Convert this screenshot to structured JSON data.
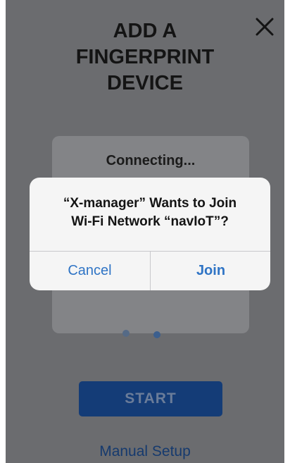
{
  "header": {
    "title": "ADD A\nFINGERPRINT\nDEVICE",
    "close_icon": "close-x"
  },
  "status_card": {
    "status_text": "Connecting..."
  },
  "start_button": {
    "label": "START"
  },
  "manual_setup_link": {
    "label": "Manual Setup"
  },
  "alert": {
    "message": "“X-manager” Wants to Join\nWi-Fi Network “navIoT”?",
    "cancel_label": "Cancel",
    "join_label": "Join"
  },
  "colors": {
    "overlay_background": "#6b6c6f",
    "alert_background": "#f5f5f5",
    "alert_button_text": "#2f74c5",
    "start_button": "#143c77"
  }
}
